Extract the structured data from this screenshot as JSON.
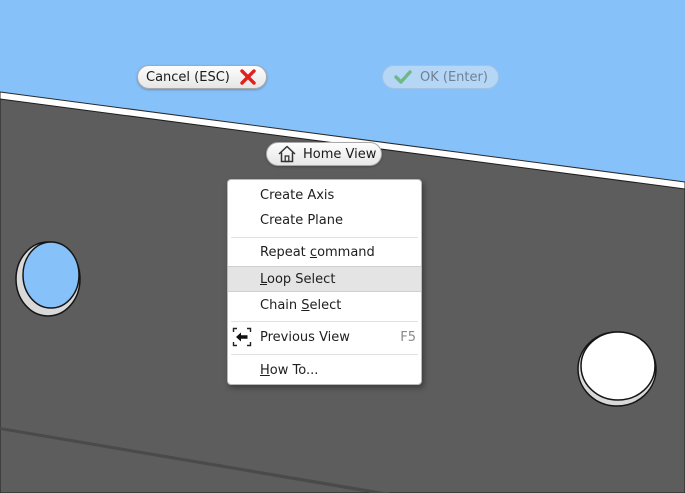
{
  "scene": {
    "background_color": "#87c1fa",
    "part_color": "#5a5a5a",
    "part_edge_color": "#ffffff"
  },
  "marking_menu": {
    "cancel": {
      "label": "Cancel (ESC)",
      "icon": "red-x-icon"
    },
    "ok": {
      "label": "OK (Enter)",
      "icon": "green-check-icon",
      "enabled": false
    },
    "home": {
      "label": "Home View",
      "icon": "home-icon"
    }
  },
  "context_menu": {
    "items": [
      {
        "label": "Create Axis",
        "mnemonic": ""
      },
      {
        "label": "Create Plane",
        "mnemonic": ""
      },
      {
        "before": "Repeat ",
        "mnemonic": "c",
        "after": "ommand"
      },
      {
        "before": "",
        "mnemonic": "L",
        "after": "oop Select",
        "highlighted": true
      },
      {
        "before": "Chain ",
        "mnemonic": "S",
        "after": "elect"
      },
      {
        "label": "Previous View",
        "shortcut": "F5",
        "icon": "previous-view-icon"
      },
      {
        "before": "",
        "mnemonic": "H",
        "after": "ow To..."
      }
    ]
  }
}
